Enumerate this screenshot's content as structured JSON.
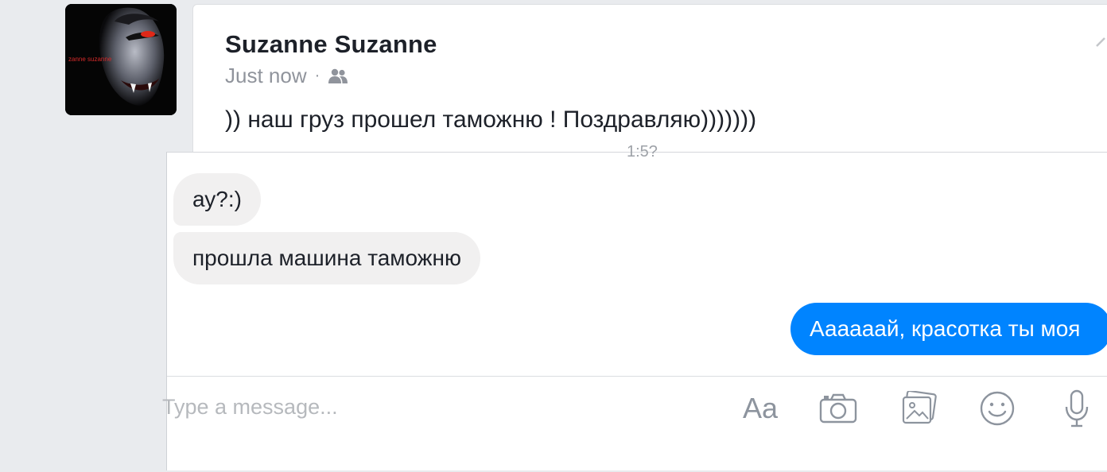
{
  "post": {
    "author_name": "Suzanne Suzanne",
    "avatar_caption": "zanne suzanne",
    "timestamp": "Just now",
    "separator": "·",
    "audience_icon": "friends-icon",
    "text": ")) наш груз прошел таможню ! Поздравляю)))))))"
  },
  "chat": {
    "time_peek": "1:5?",
    "messages": [
      {
        "direction": "incoming",
        "text": "ау?:)"
      },
      {
        "direction": "incoming",
        "text": "прошла машина таможню"
      },
      {
        "direction": "outgoing",
        "text": "Аааааай, красотка ты моя"
      }
    ],
    "composer": {
      "placeholder": "Type a message...",
      "text_tool_label": "Aa",
      "tools": [
        "text-format-icon",
        "camera-icon",
        "photo-gallery-icon",
        "emoji-icon",
        "microphone-icon"
      ]
    }
  },
  "colors": {
    "page_background": "#e9ebee",
    "outgoing_bubble": "#0084ff",
    "incoming_bubble": "#f1f0f0",
    "icon_gray": "#8d949e"
  }
}
